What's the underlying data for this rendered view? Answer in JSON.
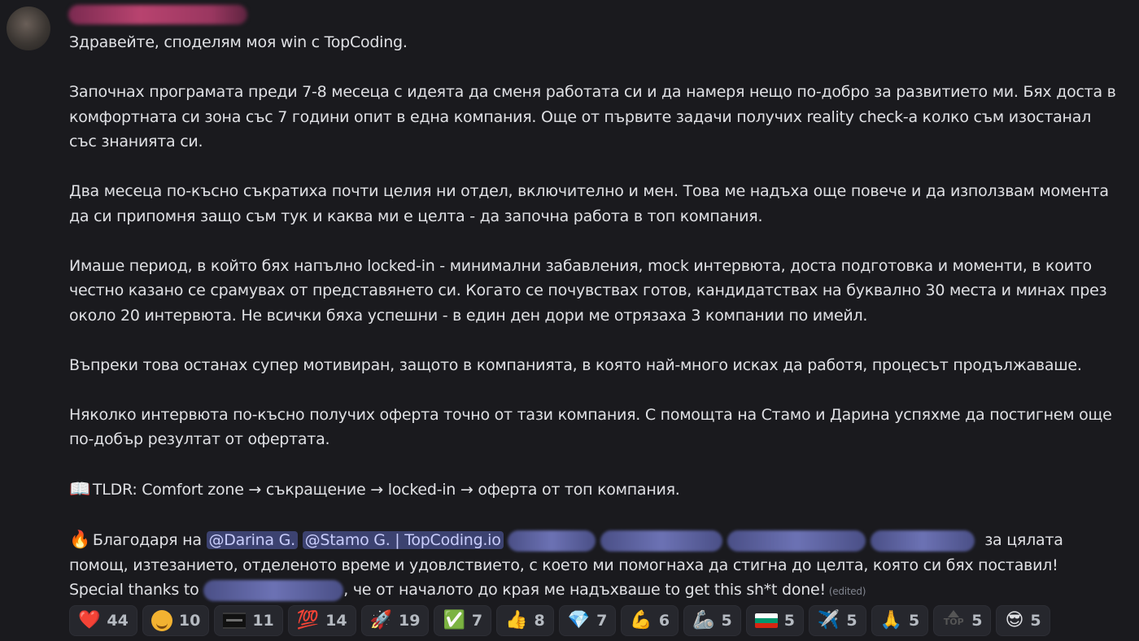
{
  "message": {
    "p1": "Здравейте, споделям моя win с TopCoding.",
    "p2": "Започнах програмата преди 7-8 месеца с идеята да сменя работата си и да намеря нещо по-добро за развитието ми. Бях доста в комфортната си зона със 7 години опит в една компания. Още от първите задачи получих reality check-a колко съм изостанал със знанията си.",
    "p3": "Два месеца по-късно съкратиха почти целия ни отдел, включително и мен. Това ме надъха още повече и да използвам момента да си припомня защо съм тук и каква ми е целта - да започна работа в топ компания.",
    "p4": "Имаше период, в който бях напълно locked-in - минимални забавления, mock интервюта, доста подготовка и моменти, в които честно казано се срамувах от представянето си. Когато се почувствах готов, кандидатствах на буквално 30 места и минах през около 20 интервюта. Не всички бяха успешни - в един ден дори ме отрязаха 3 компании по имейл.",
    "p5": "Въпреки това останах супер мотивиран, защото в компанията, в която най-много исках да работя, процесът продължаваше.",
    "p6": "Няколко интервюта по-късно получих оферта точно от тази компания. С помощта на Стамо и Дарина успяхме да постигнем още по-добър резултат от офертата.",
    "tldr_emoji": "📖",
    "tldr": "TLDR: Comfort zone → съкращение → locked-in → оферта от топ компания.",
    "thanks_emoji": "🔥",
    "thanks_prefix": "Благодаря на",
    "mention1": "@Darina G.",
    "mention2": "@Stamo G. | TopCoding.io",
    "thanks_suffix": "за цялата помощ, изтезанието, отделеното време и удовлствието, с което ми помогнаха да стигна до целта, която си бях поставил!",
    "special_prefix": "Special thanks to",
    "special_suffix": ", че от началото до края ме надъхваше to get this sh*t done!",
    "edited": "(edited)"
  },
  "reactions": [
    {
      "emoji": "❤️",
      "icon": "heart-icon",
      "count": "44"
    },
    {
      "emoji": "",
      "icon": "custom-face-icon",
      "count": "10"
    },
    {
      "emoji": "",
      "icon": "custom-dark-flag-icon",
      "count": "11"
    },
    {
      "emoji": "💯",
      "icon": "hundred-icon",
      "count": "14"
    },
    {
      "emoji": "🚀",
      "icon": "rocket-icon",
      "count": "19"
    },
    {
      "emoji": "✅",
      "icon": "check-mark-icon",
      "count": "7"
    },
    {
      "emoji": "👍",
      "icon": "thumbs-up-icon",
      "count": "8"
    },
    {
      "emoji": "💎",
      "icon": "gem-icon",
      "count": "7"
    },
    {
      "emoji": "💪",
      "icon": "flexed-biceps-icon",
      "count": "6"
    },
    {
      "emoji": "🦾",
      "icon": "mechanical-arm-icon",
      "count": "5"
    },
    {
      "emoji": "",
      "icon": "bulgaria-flag-icon",
      "count": "5"
    },
    {
      "emoji": "✈️",
      "icon": "airplane-icon",
      "count": "5"
    },
    {
      "emoji": "🙏",
      "icon": "folded-hands-icon",
      "count": "5"
    },
    {
      "emoji": "",
      "icon": "top-icon",
      "label": "TOP",
      "count": "5"
    },
    {
      "emoji": "😎",
      "icon": "sunglasses-face-icon",
      "count": "5"
    }
  ],
  "colors": {
    "background": "#1a1a1e",
    "text": "#dfe0e4",
    "mention_bg": "#3c4270",
    "mention_text": "#c9cdfb"
  }
}
